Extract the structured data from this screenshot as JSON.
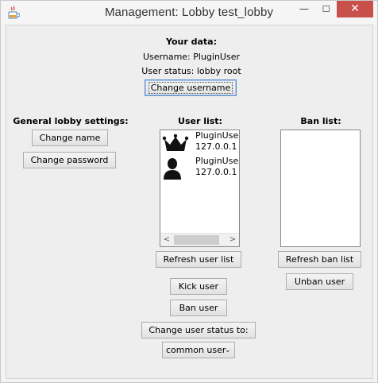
{
  "window": {
    "title": "Management: Lobby test_lobby",
    "minimize_glyph": "—",
    "maximize_glyph": "☐",
    "close_glyph": "✕",
    "icon": "java-cup-icon"
  },
  "your_data": {
    "heading": "Your data:",
    "username_line": "Username: PluginUser",
    "status_line": "User status: lobby root",
    "change_username_label": "Change username"
  },
  "general": {
    "heading": "General lobby settings:",
    "change_name_label": "Change name",
    "change_password_label": "Change password"
  },
  "user_list": {
    "heading": "User list:",
    "users": [
      {
        "name": "PluginUser",
        "ip": "127.0.0.1",
        "icon": "crown-icon"
      },
      {
        "name": "PluginUser(",
        "ip": "127.0.0.1",
        "icon": "person-icon"
      }
    ],
    "scroll_left": "<",
    "scroll_right": ">",
    "refresh_label": "Refresh user list",
    "kick_label": "Kick user",
    "ban_label": "Ban user",
    "change_status_label": "Change user status to:",
    "status_option": "common user"
  },
  "ban_list": {
    "heading": "Ban list:",
    "refresh_label": "Refresh ban list",
    "unban_label": "Unban user"
  }
}
